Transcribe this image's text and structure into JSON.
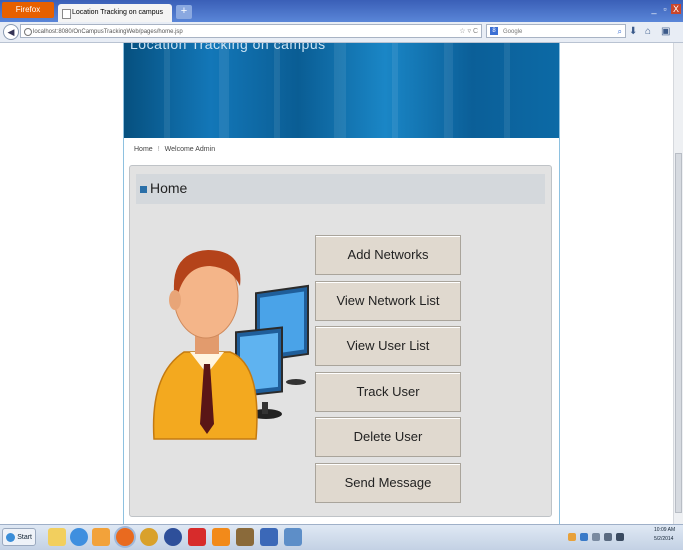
{
  "browser": {
    "menu_button": "Firefox",
    "tab_title": "Location Tracking on campus",
    "new_tab": "+",
    "url": "localhost:8080/OnCampusTrackingWeb/pages/home.jsp",
    "search_placeholder": "Google",
    "window_min": "_",
    "window_max": "▫",
    "window_close": "X"
  },
  "page": {
    "banner_title": "Location Tracking on campus",
    "breadcrumb": {
      "home": "Home",
      "separator": "!",
      "user": "Welcome Admin"
    },
    "panel_title": "Home",
    "menu": [
      {
        "label": "Add Networks"
      },
      {
        "label": "View Network List"
      },
      {
        "label": "View User List"
      },
      {
        "label": "Track User"
      },
      {
        "label": "Delete User"
      },
      {
        "label": "Send Message"
      }
    ]
  },
  "taskbar": {
    "start_label": "Start",
    "clock_time": "10:09 AM",
    "clock_date": "5/2/2014",
    "apps": [
      "folder-icon",
      "ie-icon",
      "media-icon",
      "firefox-icon",
      "chrome-icon",
      "globe-icon",
      "pdf-icon",
      "vlc-icon",
      "photo-icon",
      "word-icon",
      "image-icon"
    ]
  },
  "colors": {
    "banner": "#0b6aa6",
    "panel": "#e2e2e2",
    "button": "#e0d9cf",
    "accent": "#2a6fa8"
  }
}
